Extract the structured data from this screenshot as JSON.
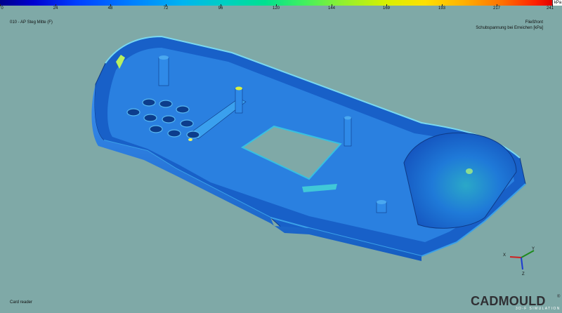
{
  "app": {
    "logo": "CADMOULD",
    "logo_reg": "®",
    "logo_sub": "3D-F SIMULATION"
  },
  "colors": {
    "background": "#7fa9a7",
    "part_base": "#1c68d0",
    "part_light": "#3a8ae8",
    "hotspot": "#c8f040"
  },
  "scale": {
    "unit": "kPa",
    "ticks": [
      "0",
      "24",
      "48",
      "72",
      "96",
      "120",
      "144",
      "169",
      "193",
      "217",
      "241"
    ]
  },
  "analysis_title": "010 - AP Steg Mitte (F)",
  "result": {
    "line1": "Fließfront",
    "line2": "Schubspannung bei Erreichen [kPa]"
  },
  "model_name": "Card reader",
  "axes": {
    "x": "X",
    "y": "Y",
    "z": "Z"
  }
}
